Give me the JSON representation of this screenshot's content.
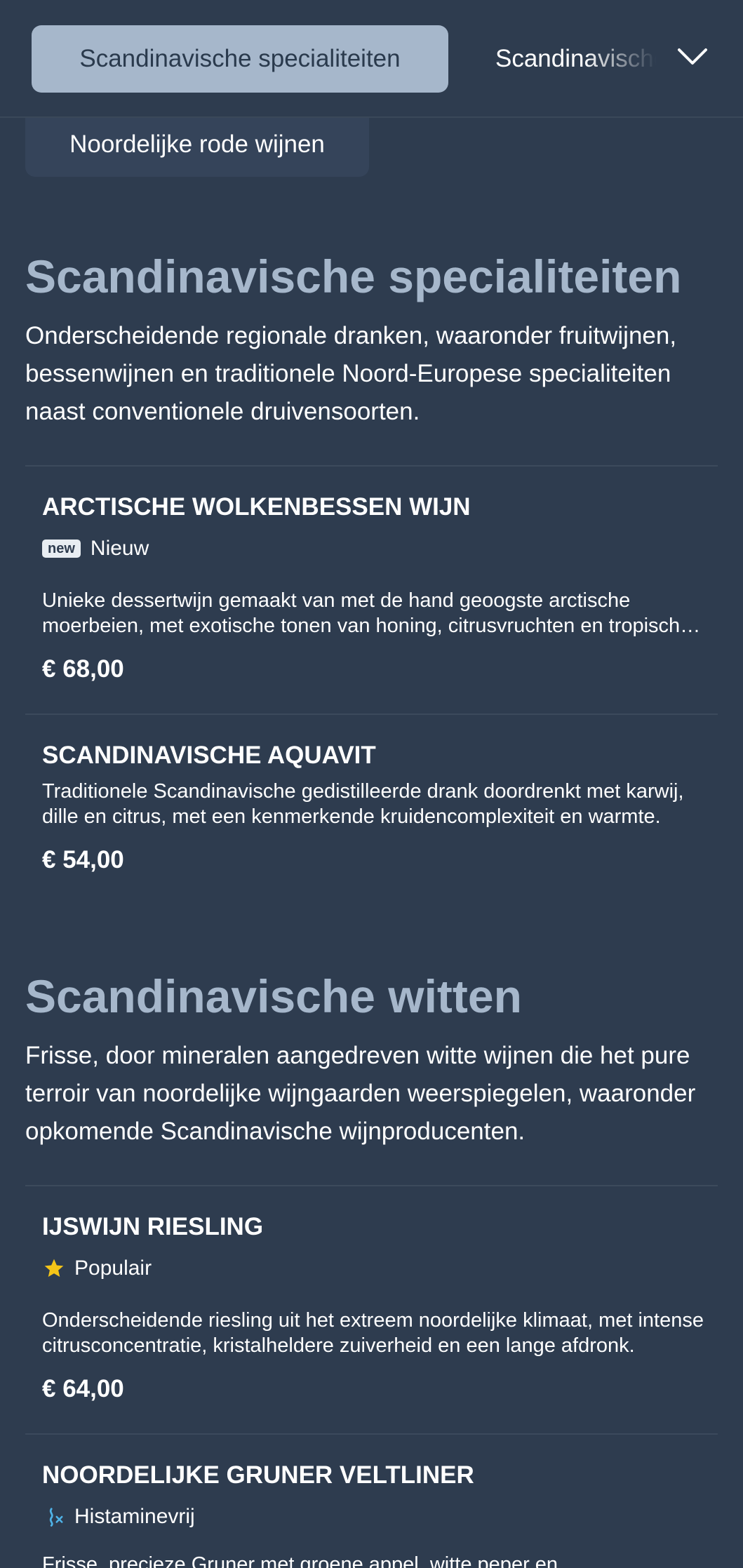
{
  "nav": {
    "active_tab": "Scandinavische specialiteiten",
    "next_tab": "Scandinavische witten",
    "secondary_tab": "Noordelijke rode wijnen"
  },
  "sections": [
    {
      "title": "Scandinavische specialiteiten",
      "description": "Onderscheidende regionale dranken, waaronder fruitwijnen, bessenwijnen en traditionele Noord-Europese specialiteiten naast conventionele druivensoorten.",
      "items": [
        {
          "name": "ARCTISCHE WOLKENBESSEN WIJN",
          "badge": "new",
          "tag": "Nieuw",
          "description": "Unieke dessertwijn gemaakt van met de hand geoogste arctische moerbeien, met exotische tonen van honing, citrusvruchten en tropisch fruit.",
          "price": "€ 68,00"
        },
        {
          "name": "SCANDINAVISCHE AQUAVIT",
          "description": "Traditionele Scandinavische gedistilleerde drank doordrenkt met karwij, dille en citrus, met een kenmerkende kruidencomplexiteit en warmte.",
          "price": "€ 54,00"
        }
      ]
    },
    {
      "title": "Scandinavische witten",
      "description": "Frisse, door mineralen aangedreven witte wijnen die het pure terroir van noordelijke wijngaarden weerspiegelen, waaronder opkomende Scandinavische wijnproducenten.",
      "items": [
        {
          "name": "IJSWIJN RIESLING",
          "tag": "Populair",
          "tag_icon": "star-icon",
          "description": "Onderscheidende riesling uit het extreem noordelijke klimaat, met intense citrusconcentratie, kristalheldere zuiverheid en een lange afdronk.",
          "price": "€ 64,00"
        },
        {
          "name": "NOORDELIJKE GRUNER VELTLINER",
          "tag": "Histaminevrij",
          "tag_icon": "histamine-free-icon",
          "description": "Frisse, precieze Gruner met groene appel, witte peper en"
        }
      ]
    }
  ],
  "colors": {
    "background": "#2e3c4f",
    "accent": "#a6b7cb",
    "star": "#f5c518",
    "histamine_icon": "#4fb3e8"
  }
}
